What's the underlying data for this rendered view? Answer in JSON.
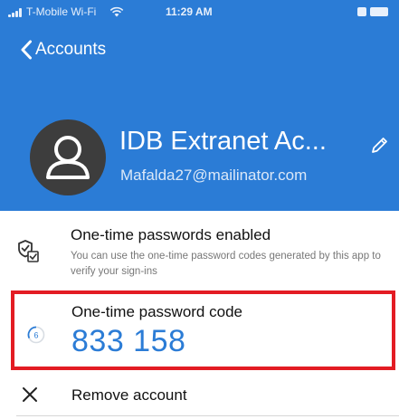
{
  "status_bar": {
    "carrier": "T-Mobile Wi-Fi",
    "time": "11:29 AM",
    "icons": [
      "signal-icon",
      "wifi-icon",
      "do-not-disturb-icon",
      "battery-icon"
    ]
  },
  "nav": {
    "back_label": "Accounts",
    "back_icon": "chevron-left-icon"
  },
  "account": {
    "name": "IDB Extranet Ac...",
    "email": "Mafalda27@mailinator.com",
    "avatar_icon": "user-icon",
    "edit_icon": "pencil-icon"
  },
  "otp_enabled": {
    "icon": "shield-check-icon",
    "title": "One-time passwords enabled",
    "description": "You can use the one-time password codes generated by this app to verify your sign-ins"
  },
  "otp_code": {
    "icon": "timer-icon",
    "label": "One-time password code",
    "code": "833 158",
    "timer_value": "6"
  },
  "remove": {
    "icon": "close-icon",
    "label": "Remove account"
  },
  "colors": {
    "header_blue": "#2b7cd6",
    "code_blue": "#2b7cd6",
    "highlight_red": "#e31c23",
    "avatar_dark": "#3d3d3d"
  }
}
